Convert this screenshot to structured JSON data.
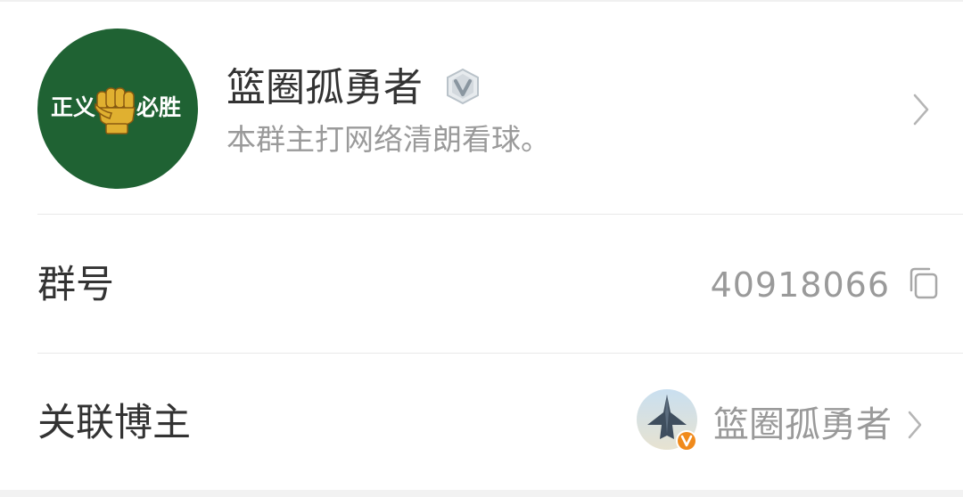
{
  "group": {
    "name": "篮圈孤勇者",
    "description": "本群主打网络清朗看球。",
    "avatar_text_left": "正义",
    "avatar_text_right": "必胜"
  },
  "rows": {
    "group_id_label": "群号",
    "group_id_value": "40918066",
    "blogger_label": "关联博主",
    "blogger_name": "篮圈孤勇者"
  },
  "icons": {
    "verify": "verified-v-icon",
    "chevron": "chevron-right-icon",
    "copy": "copy-icon",
    "fist": "fist-icon"
  },
  "colors": {
    "avatar_bg": "#1f6233",
    "fist": "#e0b030",
    "primary_text": "#333333",
    "secondary_text": "#9a9a9a",
    "badge_orange": "#f08a1c"
  }
}
